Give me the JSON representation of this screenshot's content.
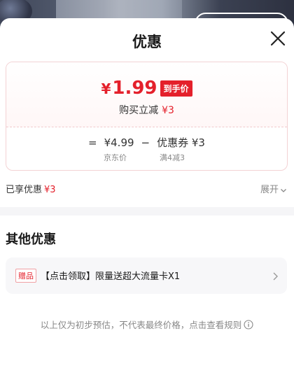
{
  "header": {
    "title": "优惠"
  },
  "price_card": {
    "currency_symbol": "¥",
    "final_price": "1.99",
    "final_tag": "到手价",
    "buy_discount_label": "购买立减",
    "buy_discount_value": "¥3",
    "equals": "=",
    "list_price": "¥4.99",
    "list_price_label": "京东价",
    "minus": "−",
    "coupon": "优惠券 ¥3",
    "coupon_condition": "满4减3"
  },
  "summary": {
    "enjoyed_label": "已享优惠",
    "enjoyed_value": "¥3",
    "expand_label": "展开"
  },
  "other": {
    "title": "其他优惠",
    "gift_tag": "赠品",
    "gift_text": "【点击领取】限量送超大流量卡X1"
  },
  "footnote": {
    "text": "以上仅为初步预估，不代表最终价格，点击查看规则"
  },
  "colors": {
    "accent": "#e4202b",
    "muted": "#888888",
    "panel": "#f7f7f9"
  },
  "icons": [
    "close-icon",
    "chevron-down-icon",
    "chevron-right-icon",
    "info-icon"
  ]
}
